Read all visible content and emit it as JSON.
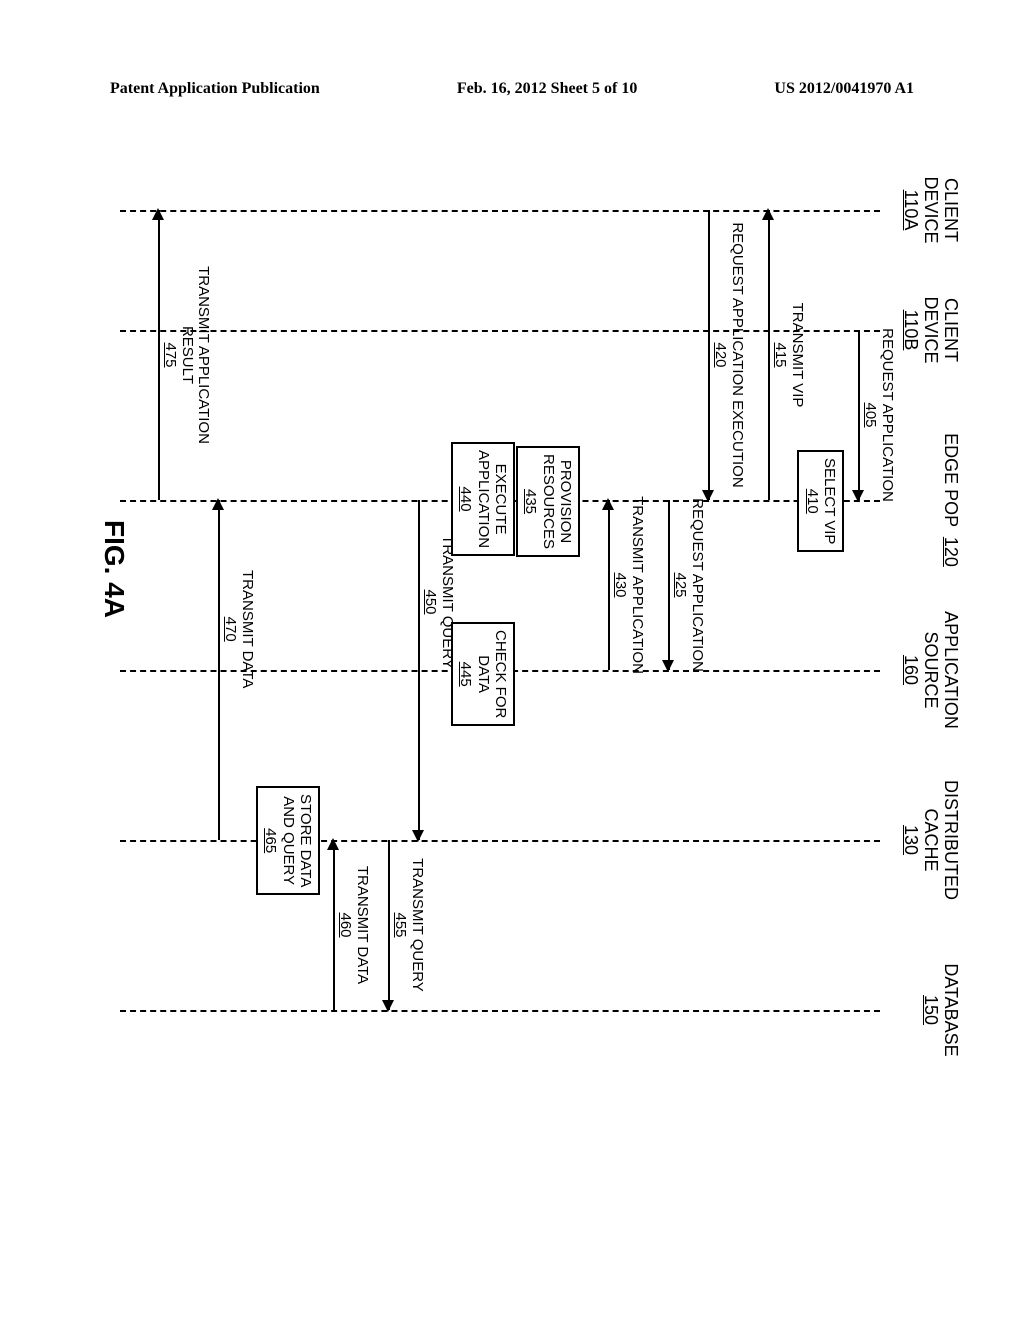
{
  "header": {
    "left": "Patent Application Publication",
    "center": "Feb. 16, 2012  Sheet 5 of 10",
    "right": "US 2012/0041970 A1"
  },
  "lifelines": {
    "clientA": {
      "l1": "CLIENT",
      "l2": "DEVICE",
      "num": "110A"
    },
    "clientB": {
      "l1": "CLIENT",
      "l2": "DEVICE",
      "num": "110B"
    },
    "edgePop": {
      "l1": "EDGE POP",
      "l2": "",
      "num": "120"
    },
    "appSource": {
      "l1": "APPLICATION",
      "l2": "SOURCE",
      "num": "160"
    },
    "distCache": {
      "l1": "DISTRIBUTED",
      "l2": "CACHE",
      "num": "130"
    },
    "database": {
      "l1": "DATABASE",
      "l2": "",
      "num": "150"
    }
  },
  "steps": {
    "s405": {
      "text": "REQUEST APPLICATION",
      "num": "405"
    },
    "s410": {
      "text": "SELECT VIP",
      "num": "410"
    },
    "s415": {
      "text": "TRANSMIT VIP",
      "num": "415"
    },
    "s420": {
      "text": "REQUEST APPLICATION EXECUTION",
      "num": "420"
    },
    "s425": {
      "text": "REQUEST APPLICATION",
      "num": "425"
    },
    "s430": {
      "text": "TRANSMIT APPLICATION",
      "num": "430"
    },
    "s435": {
      "l1": "PROVISION",
      "l2": "RESOURCES",
      "num": "435"
    },
    "s440": {
      "l1": "EXECUTE",
      "l2": "APPLICATION",
      "num": "440"
    },
    "s445": {
      "l1": "CHECK FOR",
      "l2": "DATA",
      "num": "445"
    },
    "s450": {
      "text": "TRANSMIT QUERY",
      "num": "450"
    },
    "s455": {
      "text": "TRANSMIT QUERY",
      "num": "455"
    },
    "s460": {
      "text": "TRANSMIT DATA",
      "num": "460"
    },
    "s465": {
      "l1": "STORE DATA",
      "l2": "AND QUERY",
      "num": "465"
    },
    "s470": {
      "text": "TRANSMIT DATA",
      "num": "470"
    },
    "s475": {
      "l1": "TRANSMIT APPLICATION",
      "l2": "RESULT",
      "num": "475"
    }
  },
  "figure_label": "FIG. 4A"
}
